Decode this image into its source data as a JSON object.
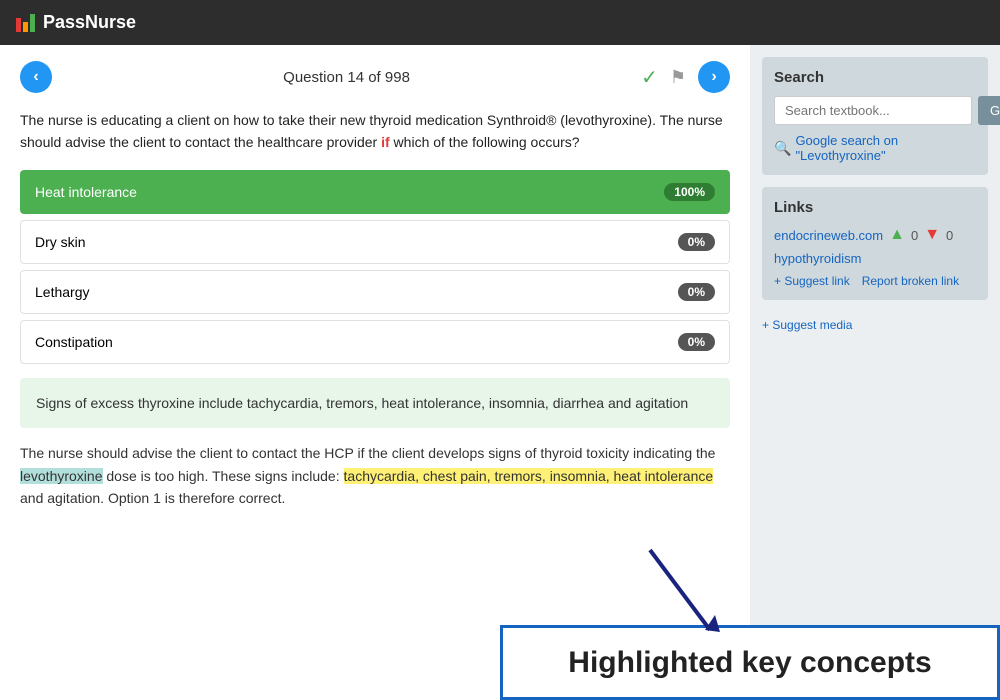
{
  "header": {
    "logo_text": "PassNurse",
    "logo_bars": [
      "red",
      "orange",
      "green"
    ]
  },
  "navigation": {
    "prev_label": "‹",
    "next_label": "›",
    "question_counter": "Question 14 of 998",
    "checkmark": "✓",
    "flag": "⚑"
  },
  "question": {
    "text_part1": "The nurse is educating a client on how to take their new thyroid medication Synthroid®\n(levothyroxine). The nurse should advise the client to contact the healthcare provider ",
    "text_highlight_red": "if",
    "text_part2": " which of the following occurs?",
    "options": [
      {
        "label": "Heat intolerance",
        "badge": "100%",
        "correct": true
      },
      {
        "label": "Dry skin",
        "badge": "0%",
        "correct": false
      },
      {
        "label": "Lethargy",
        "badge": "0%",
        "correct": false
      },
      {
        "label": "Constipation",
        "badge": "0%",
        "correct": false
      }
    ]
  },
  "explanation": {
    "box_text": "Signs of excess thyroxine include tachycardia, tremors, heat intolerance,\ninsomnia, diarrhea and agitation",
    "main_text": "The nurse should advise the client to contact the HCP if the client develops signs of thyroid toxicity indicating the levothyroxine dose is too high. These signs include: tachycardia, chest pain, tremors, insomnia, heat intolerance and agitation. Option 1 is therefore correct."
  },
  "search": {
    "title": "Search",
    "placeholder": "Search textbook...",
    "go_label": "Go",
    "google_link_text": "Google search on\n\"Levothyroxine\""
  },
  "links": {
    "title": "Links",
    "items": [
      {
        "url": "endocrineweb.com",
        "up_votes": "0",
        "down_votes": "0"
      }
    ],
    "sub_link": "hypothyroidism",
    "suggest_link": "+ Suggest link",
    "report_link": "Report broken link",
    "suggest_media": "+ Suggest media"
  },
  "highlighted_key": {
    "text": "Highlighted key concepts"
  }
}
